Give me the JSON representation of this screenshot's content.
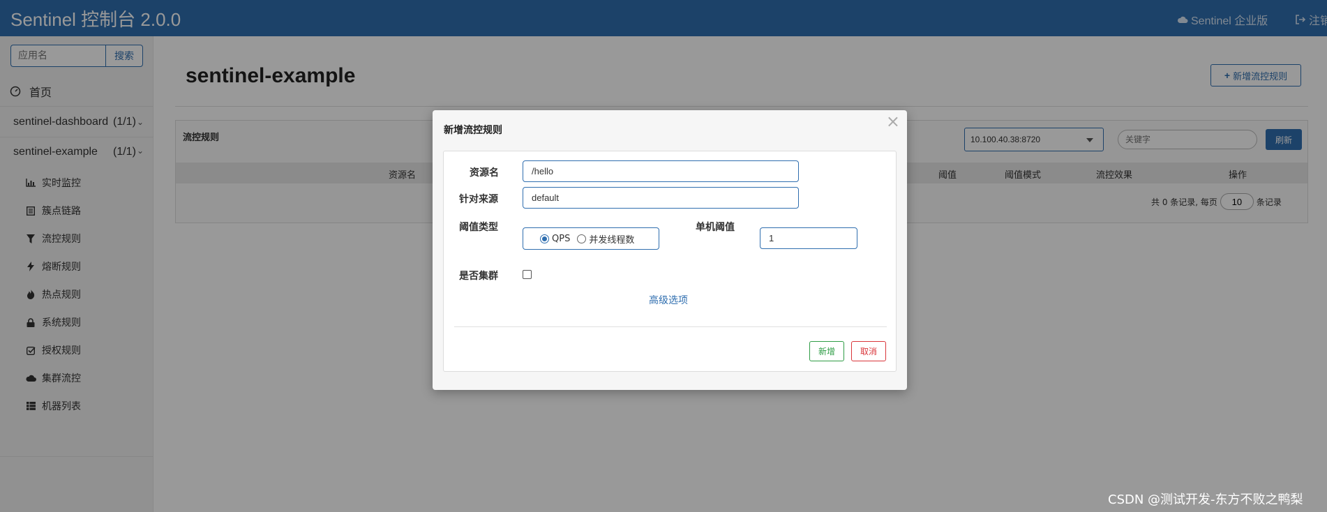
{
  "header": {
    "brand": "Sentinel 控制台 2.0.0",
    "enterprise_link": "Sentinel 企业版",
    "logout_link": "注销"
  },
  "sidebar": {
    "search_placeholder": "应用名",
    "search_button": "搜索",
    "home_label": "首页",
    "apps": [
      {
        "name": "sentinel-dashboard",
        "count": "(1/1)"
      },
      {
        "name": "sentinel-example",
        "count": "(1/1)"
      }
    ],
    "sub_items": [
      {
        "label": "实时监控",
        "icon": "bar-chart-icon"
      },
      {
        "label": "簇点链路",
        "icon": "list-icon"
      },
      {
        "label": "流控规则",
        "icon": "filter-icon"
      },
      {
        "label": "熔断规则",
        "icon": "flash-icon"
      },
      {
        "label": "热点规则",
        "icon": "fire-icon"
      },
      {
        "label": "系统规则",
        "icon": "lock-icon"
      },
      {
        "label": "授权规则",
        "icon": "check-icon"
      },
      {
        "label": "集群流控",
        "icon": "cloud-icon"
      },
      {
        "label": "机器列表",
        "icon": "grid-icon"
      }
    ]
  },
  "main": {
    "page_title": "sentinel-example",
    "add_rule_button": "新增流控规则",
    "panel_title": "流控规则",
    "machine_select": "10.100.40.38:8720",
    "keyword_placeholder": "关键字",
    "refresh_button": "刷新",
    "columns": [
      "资源名",
      "阈值",
      "阈值模式",
      "流控效果",
      "操作"
    ],
    "pager": {
      "prefix": "共 0 条记录, 每页",
      "page_size": "10",
      "suffix": "条记录"
    }
  },
  "modal": {
    "title": "新增流控规则",
    "close": "×",
    "resource_label": "资源名",
    "resource_value": "/hello",
    "origin_label": "针对来源",
    "origin_value": "default",
    "grade_label": "阈值类型",
    "grade_options": [
      "QPS",
      "并发线程数"
    ],
    "grade_selected": "QPS",
    "threshold_label": "单机阈值",
    "threshold_value": "1",
    "cluster_label": "是否集群",
    "cluster_checked": false,
    "advanced_link": "高级选项",
    "add_button": "新增",
    "cancel_button": "取消"
  },
  "watermark": "CSDN @测试开发-东方不败之鸭梨",
  "colors": {
    "primary": "#2f6eaf",
    "success": "#2e9c45",
    "danger": "#d9353a"
  }
}
